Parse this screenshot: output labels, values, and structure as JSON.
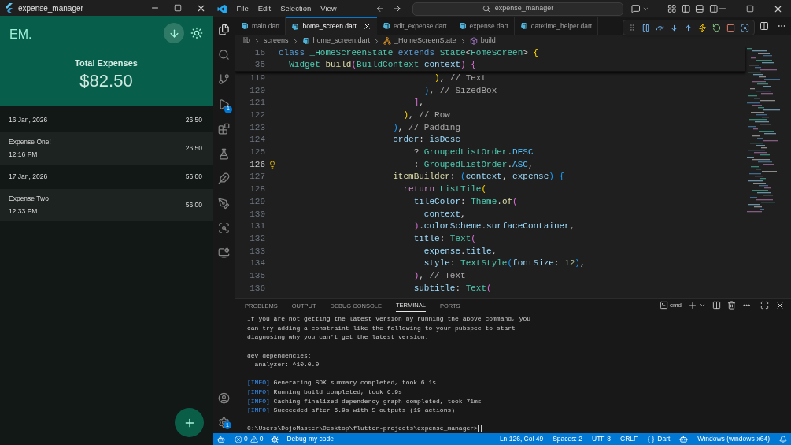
{
  "app_window": {
    "title": "expense_manager",
    "logo": "EM.",
    "header_label": "Total Expenses",
    "total": "$82.50",
    "groups": [
      {
        "date": "16 Jan, 2026",
        "sum": "26.50",
        "items": [
          {
            "title": "Expense One!",
            "time": "12:16 PM",
            "amount": "26.50"
          }
        ]
      },
      {
        "date": "17 Jan, 2026",
        "sum": "56.00",
        "items": [
          {
            "title": "Expense Two",
            "time": "12:33 PM",
            "amount": "56.00"
          }
        ]
      }
    ]
  },
  "vscode": {
    "menu": [
      "File",
      "Edit",
      "Selection",
      "View",
      "···"
    ],
    "search": "expense_manager",
    "tabs": [
      {
        "label": "main.dart",
        "selected": false
      },
      {
        "label": "home_screen.dart",
        "selected": true
      },
      {
        "label": "edit_expense.dart",
        "selected": false
      },
      {
        "label": "expense.dart",
        "selected": false
      },
      {
        "label": "datetime_helper.dart",
        "selected": false
      }
    ],
    "breadcrumb": [
      {
        "kind": "folder",
        "text": "lib"
      },
      {
        "kind": "folder",
        "text": "screens"
      },
      {
        "kind": "file",
        "text": "home_screen.dart"
      },
      {
        "kind": "class",
        "text": "_HomeScreenState"
      },
      {
        "kind": "method",
        "text": "build"
      }
    ],
    "activity_badges": {
      "debug": "1",
      "settings": "1"
    },
    "sticky_lines": [
      {
        "number": "16",
        "tokens": [
          {
            "kind": "kw",
            "text": "class "
          },
          {
            "kind": "type",
            "text": "_HomeScreenState "
          },
          {
            "kind": "kw",
            "text": "extends "
          },
          {
            "kind": "type",
            "text": "State"
          },
          {
            "kind": "plain",
            "text": "<"
          },
          {
            "kind": "type",
            "text": "HomeScreen"
          },
          {
            "kind": "plain",
            "text": "> "
          },
          {
            "kind": "b1",
            "text": "{"
          }
        ]
      },
      {
        "number": "35",
        "tokens": [
          {
            "kind": "type",
            "text": "  Widget "
          },
          {
            "kind": "fn",
            "text": "build"
          },
          {
            "kind": "b2",
            "text": "("
          },
          {
            "kind": "type",
            "text": "BuildContext "
          },
          {
            "kind": "var",
            "text": "context"
          },
          {
            "kind": "b2",
            "text": ")"
          },
          {
            "kind": "b2",
            "text": " {"
          }
        ]
      }
    ],
    "code_lines": [
      {
        "number": "119",
        "selected": false,
        "lightbulb": false,
        "tokens": [
          {
            "kind": "b1",
            "text": "                              )"
          },
          {
            "kind": "plain",
            "text": ", "
          },
          {
            "kind": "comment",
            "text": "// Text"
          }
        ]
      },
      {
        "number": "120",
        "selected": false,
        "lightbulb": false,
        "tokens": [
          {
            "kind": "b3",
            "text": "                            )"
          },
          {
            "kind": "plain",
            "text": ", "
          },
          {
            "kind": "comment",
            "text": "// SizedBox"
          }
        ]
      },
      {
        "number": "121",
        "selected": false,
        "lightbulb": false,
        "tokens": [
          {
            "kind": "b2",
            "text": "                          ]"
          },
          {
            "kind": "plain",
            "text": ","
          }
        ]
      },
      {
        "number": "122",
        "selected": false,
        "lightbulb": false,
        "tokens": [
          {
            "kind": "b1",
            "text": "                        )"
          },
          {
            "kind": "plain",
            "text": ", "
          },
          {
            "kind": "comment",
            "text": "// Row"
          }
        ]
      },
      {
        "number": "123",
        "selected": false,
        "lightbulb": false,
        "tokens": [
          {
            "kind": "b3",
            "text": "                      )"
          },
          {
            "kind": "plain",
            "text": ", "
          },
          {
            "kind": "comment",
            "text": "// Padding"
          }
        ]
      },
      {
        "number": "124",
        "selected": false,
        "lightbulb": false,
        "tokens": [
          {
            "kind": "var",
            "text": "                      order"
          },
          {
            "kind": "plain",
            "text": ": "
          },
          {
            "kind": "var",
            "text": "isDesc"
          }
        ]
      },
      {
        "number": "125",
        "selected": false,
        "lightbulb": false,
        "tokens": [
          {
            "kind": "plain",
            "text": "                          ? "
          },
          {
            "kind": "type",
            "text": "GroupedListOrder"
          },
          {
            "kind": "plain",
            "text": "."
          },
          {
            "kind": "enum",
            "text": "DESC"
          }
        ]
      },
      {
        "number": "126",
        "selected": true,
        "lightbulb": true,
        "tokens": [
          {
            "kind": "plain",
            "text": "                          : "
          },
          {
            "kind": "type",
            "text": "GroupedListOrder"
          },
          {
            "kind": "plain",
            "text": "."
          },
          {
            "kind": "enum",
            "text": "ASC"
          },
          {
            "kind": "plain",
            "text": ","
          }
        ]
      },
      {
        "number": "127",
        "selected": false,
        "lightbulb": false,
        "tokens": [
          {
            "kind": "fn",
            "text": "                      itemBuilder"
          },
          {
            "kind": "plain",
            "text": ": "
          },
          {
            "kind": "b3",
            "text": "("
          },
          {
            "kind": "var",
            "text": "context"
          },
          {
            "kind": "plain",
            "text": ", "
          },
          {
            "kind": "var",
            "text": "expense"
          },
          {
            "kind": "b3",
            "text": ")"
          },
          {
            "kind": "b3",
            "text": " {"
          }
        ]
      },
      {
        "number": "128",
        "selected": false,
        "lightbulb": false,
        "tokens": [
          {
            "kind": "ctrl",
            "text": "                        return "
          },
          {
            "kind": "type",
            "text": "ListTile"
          },
          {
            "kind": "b1",
            "text": "("
          }
        ]
      },
      {
        "number": "129",
        "selected": false,
        "lightbulb": false,
        "tokens": [
          {
            "kind": "var",
            "text": "                          tileColor"
          },
          {
            "kind": "plain",
            "text": ": "
          },
          {
            "kind": "type",
            "text": "Theme"
          },
          {
            "kind": "plain",
            "text": "."
          },
          {
            "kind": "fn",
            "text": "of"
          },
          {
            "kind": "b2",
            "text": "("
          }
        ]
      },
      {
        "number": "130",
        "selected": false,
        "lightbulb": false,
        "tokens": [
          {
            "kind": "var",
            "text": "                            context"
          },
          {
            "kind": "plain",
            "text": ","
          }
        ]
      },
      {
        "number": "131",
        "selected": false,
        "lightbulb": false,
        "tokens": [
          {
            "kind": "b2",
            "text": "                          )"
          },
          {
            "kind": "plain",
            "text": "."
          },
          {
            "kind": "var",
            "text": "colorScheme"
          },
          {
            "kind": "plain",
            "text": "."
          },
          {
            "kind": "var",
            "text": "surfaceContainer"
          },
          {
            "kind": "plain",
            "text": ","
          }
        ]
      },
      {
        "number": "132",
        "selected": false,
        "lightbulb": false,
        "tokens": [
          {
            "kind": "var",
            "text": "                          title"
          },
          {
            "kind": "plain",
            "text": ": "
          },
          {
            "kind": "type",
            "text": "Text"
          },
          {
            "kind": "b2",
            "text": "("
          }
        ]
      },
      {
        "number": "133",
        "selected": false,
        "lightbulb": false,
        "tokens": [
          {
            "kind": "var",
            "text": "                            expense"
          },
          {
            "kind": "plain",
            "text": "."
          },
          {
            "kind": "var",
            "text": "title"
          },
          {
            "kind": "plain",
            "text": ","
          }
        ]
      },
      {
        "number": "134",
        "selected": false,
        "lightbulb": false,
        "tokens": [
          {
            "kind": "var",
            "text": "                            style"
          },
          {
            "kind": "plain",
            "text": ": "
          },
          {
            "kind": "type",
            "text": "TextStyle"
          },
          {
            "kind": "b3",
            "text": "("
          },
          {
            "kind": "var",
            "text": "fontSize"
          },
          {
            "kind": "plain",
            "text": ": "
          },
          {
            "kind": "num",
            "text": "12"
          },
          {
            "kind": "b3",
            "text": ")"
          },
          {
            "kind": "plain",
            "text": ","
          }
        ]
      },
      {
        "number": "135",
        "selected": false,
        "lightbulb": false,
        "tokens": [
          {
            "kind": "b2",
            "text": "                          )"
          },
          {
            "kind": "plain",
            "text": ", "
          },
          {
            "kind": "comment",
            "text": "// Text"
          }
        ]
      },
      {
        "number": "136",
        "selected": false,
        "lightbulb": false,
        "tokens": [
          {
            "kind": "var",
            "text": "                          subtitle"
          },
          {
            "kind": "plain",
            "text": ": "
          },
          {
            "kind": "type",
            "text": "Text"
          },
          {
            "kind": "b2",
            "text": "("
          }
        ]
      }
    ],
    "panel_tabs": [
      {
        "label": "PROBLEMS",
        "selected": false
      },
      {
        "label": "OUTPUT",
        "selected": false
      },
      {
        "label": "DEBUG CONSOLE",
        "selected": false
      },
      {
        "label": "TERMINAL",
        "selected": true
      },
      {
        "label": "PORTS",
        "selected": false
      }
    ],
    "terminal_shell": "cmd",
    "terminal_lines": [
      {
        "kind": "text",
        "text": "If you are not getting the latest version by running the above command, you"
      },
      {
        "kind": "text",
        "text": "can try adding a constraint like the following to your pubspec to start"
      },
      {
        "kind": "text",
        "text": "diagnosing why you can't get the latest version:"
      },
      {
        "kind": "blank"
      },
      {
        "kind": "text",
        "text": "dev_dependencies:"
      },
      {
        "kind": "text",
        "text": "  analyzer: ^10.0.0"
      },
      {
        "kind": "blank"
      },
      {
        "kind": "info",
        "tag": "[INFO]",
        "text": " Generating SDK summary completed, took 6.1s"
      },
      {
        "kind": "info",
        "tag": "[INFO]",
        "text": " Running build completed, took 6.9s"
      },
      {
        "kind": "info",
        "tag": "[INFO]",
        "text": " Caching finalized dependency graph completed, took 71ms"
      },
      {
        "kind": "info",
        "tag": "[INFO]",
        "text": " Succeeded after 6.9s with 5 outputs (19 actions)"
      },
      {
        "kind": "blank"
      },
      {
        "kind": "prompt",
        "text": "C:\\Users\\DojoMaster\\Desktop\\flutter-projects\\expense_manager>"
      }
    ],
    "status_bar": {
      "errors": "0",
      "warnings": "0",
      "debug": "Debug my code",
      "position": "Ln 126, Col 49",
      "spaces": "Spaces: 2",
      "encoding": "UTF-8",
      "eol": "CRLF",
      "language": "Dart",
      "platform": "Windows (windows-x64)"
    }
  }
}
